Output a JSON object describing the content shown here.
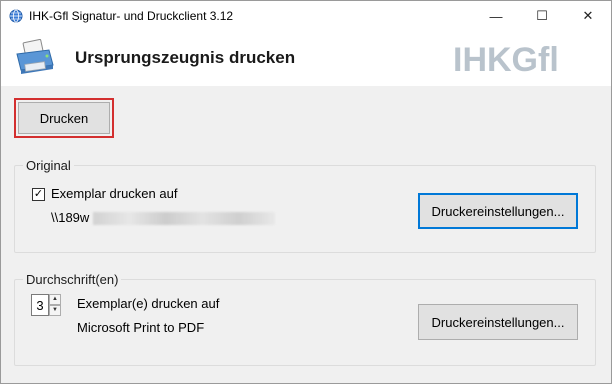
{
  "window": {
    "title": "IHK-Gfl Signatur- und Druckclient 3.12",
    "minimize_glyph": "—",
    "maximize_glyph": "☐",
    "close_glyph": "✕"
  },
  "header": {
    "title": "Ursprungszeugnis drucken",
    "logo_text": "IHKGfl",
    "logo_color": "#b9c3cc"
  },
  "toolbar": {
    "print_label": "Drucken",
    "highlight_color": "#d32f2f"
  },
  "original": {
    "legend": "Original",
    "checkbox_checked": true,
    "checkbox_glyph": "✓",
    "checkbox_label": "Exemplar drucken auf",
    "printer_path": "\\\\189w",
    "settings_label": "Druckereinstellungen..."
  },
  "copies": {
    "legend": "Durchschrift(en)",
    "count": "3",
    "up_glyph": "▲",
    "down_glyph": "▼",
    "label": "Exemplar(e) drucken auf",
    "printer_name": "Microsoft Print to PDF",
    "settings_label": "Druckereinstellungen..."
  },
  "icons": [
    "globe-icon",
    "printer-icon",
    "minimize-icon",
    "maximize-icon",
    "close-icon",
    "checkmark-icon",
    "spin-up-icon",
    "spin-down-icon"
  ]
}
